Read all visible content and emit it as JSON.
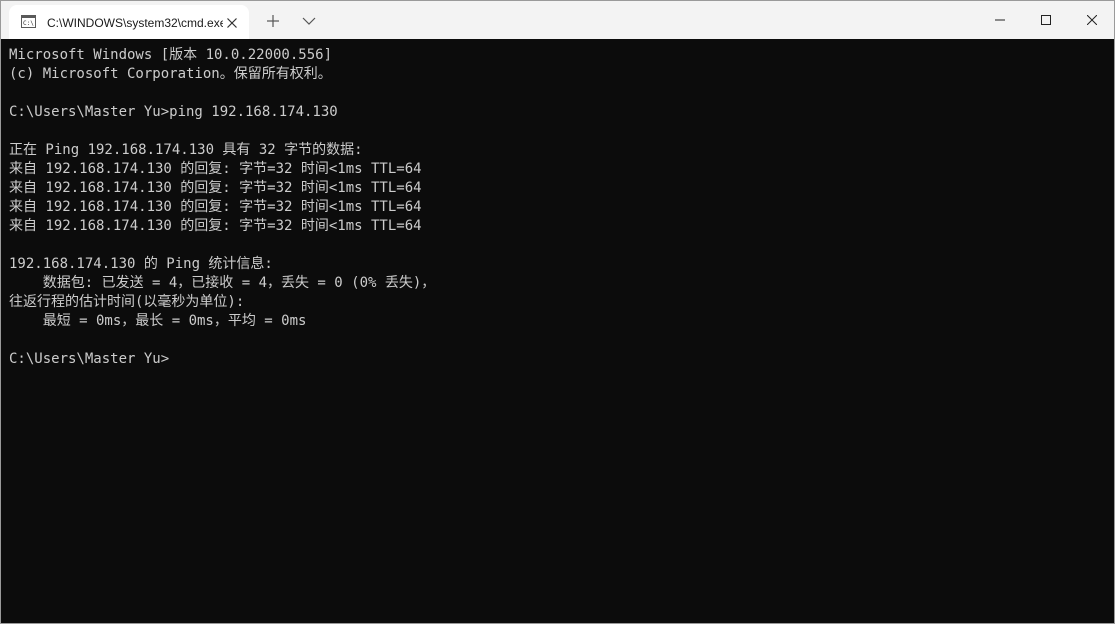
{
  "window": {
    "tab_title": "C:\\WINDOWS\\system32\\cmd.exe",
    "tab_icon": "cmd-icon",
    "tab_close_icon": "close-icon",
    "new_tab_icon": "plus-icon",
    "dropdown_icon": "chevron-down-icon",
    "minimize_icon": "minimize-icon",
    "maximize_icon": "maximize-icon",
    "close_icon": "close-icon"
  },
  "colors": {
    "titlebar": "#f3f3f3",
    "tab_active": "#ffffff",
    "console_bg": "#0c0c0c",
    "console_fg": "#cccccc"
  },
  "console": {
    "lines": [
      "Microsoft Windows [版本 10.0.22000.556]",
      "(c) Microsoft Corporation。保留所有权利。",
      "",
      "C:\\Users\\Master Yu>ping 192.168.174.130",
      "",
      "正在 Ping 192.168.174.130 具有 32 字节的数据:",
      "来自 192.168.174.130 的回复: 字节=32 时间<1ms TTL=64",
      "来自 192.168.174.130 的回复: 字节=32 时间<1ms TTL=64",
      "来自 192.168.174.130 的回复: 字节=32 时间<1ms TTL=64",
      "来自 192.168.174.130 的回复: 字节=32 时间<1ms TTL=64",
      "",
      "192.168.174.130 的 Ping 统计信息:",
      "    数据包: 已发送 = 4，已接收 = 4，丢失 = 0 (0% 丢失)，",
      "往返行程的估计时间(以毫秒为单位):",
      "    最短 = 0ms，最长 = 0ms，平均 = 0ms",
      "",
      "C:\\Users\\Master Yu>"
    ]
  }
}
